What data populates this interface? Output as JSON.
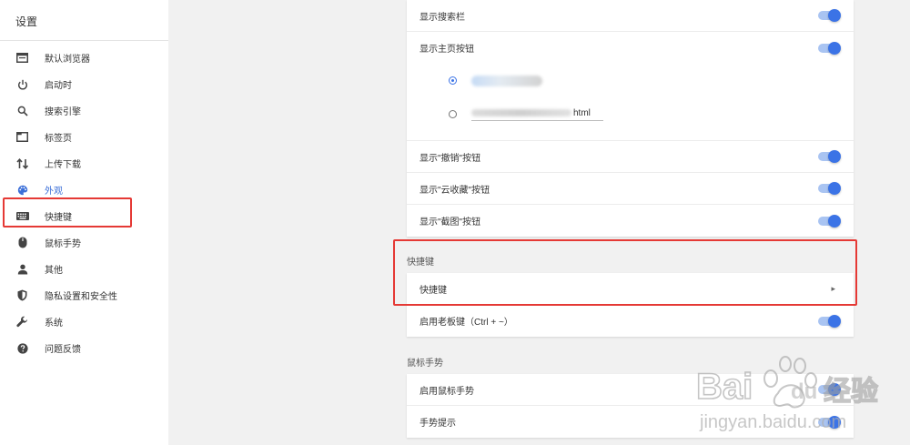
{
  "sidebar": {
    "title": "设置",
    "items": [
      {
        "label": "默认浏览器",
        "icon": "browser-window-icon"
      },
      {
        "label": "启动时",
        "icon": "power-icon"
      },
      {
        "label": "搜索引擎",
        "icon": "search-icon"
      },
      {
        "label": "标签页",
        "icon": "tab-icon"
      },
      {
        "label": "上传下载",
        "icon": "upload-download-icon"
      },
      {
        "label": "外观",
        "icon": "palette-icon",
        "active": true
      },
      {
        "label": "快捷键",
        "icon": "keyboard-icon"
      },
      {
        "label": "鼠标手势",
        "icon": "mouse-icon"
      },
      {
        "label": "其他",
        "icon": "person-icon"
      },
      {
        "label": "隐私设置和安全性",
        "icon": "shield-icon"
      },
      {
        "label": "系统",
        "icon": "wrench-icon"
      },
      {
        "label": "问题反馈",
        "icon": "help-icon"
      }
    ]
  },
  "appearance": {
    "show_search_bar": "显示搜索栏",
    "show_home_button": "显示主页按钮",
    "home_option_2_suffix": "html",
    "show_undo_button": "显示\"撤销\"按钮",
    "show_cloud_favorites_button": "显示\"云收藏\"按钮",
    "show_screenshot_button": "显示\"截图\"按钮"
  },
  "shortcuts": {
    "section_title": "快捷键",
    "shortcuts_row": "快捷键",
    "boss_key_row": "启用老板键（Ctrl + ~）"
  },
  "mouse_gestures": {
    "section_title": "鼠标手势",
    "enable_row": "启用鼠标手势",
    "hint_row": "手势提示"
  },
  "watermark": {
    "brand": "Bai",
    "brand2": "du",
    "cn": "经验",
    "url": "jingyan.baidu.com"
  },
  "colors": {
    "accent": "#3b73e6",
    "highlight_box": "#e53935"
  }
}
